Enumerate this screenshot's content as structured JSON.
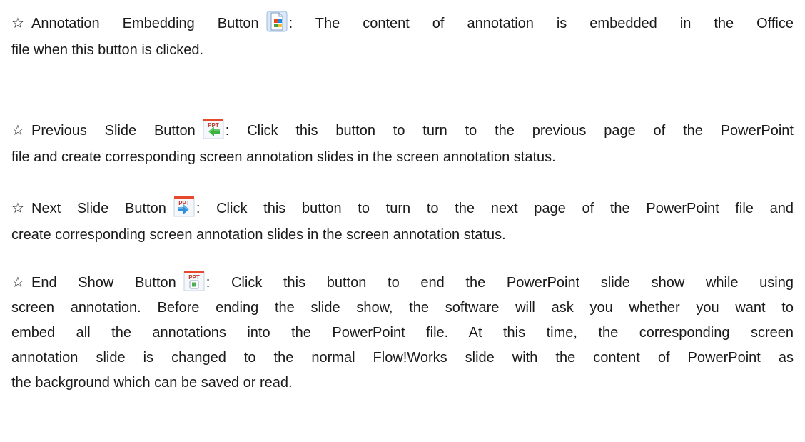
{
  "items": [
    {
      "icon": "annotation-embed-icon",
      "bullet": "☆",
      "line1_before_icon": "Annotation Embedding Button",
      "line1_after_icon": ": The content of annotation is embedded in the Office",
      "line2": "file when this button is clicked."
    },
    {
      "icon": "ppt-previous-slide-icon",
      "bullet": "☆",
      "line1_before_icon": "Previous Slide Button",
      "line1_after_icon": ": Click this button to turn to the previous page of the PowerPoint",
      "line2": "file and create corresponding screen annotation slides in the screen annotation status."
    },
    {
      "icon": "ppt-next-slide-icon",
      "bullet": "☆",
      "line1_before_icon": "Next Slide Button",
      "line1_after_icon": ": Click this button to turn to the next page of the PowerPoint file and",
      "line2": "create corresponding screen annotation slides in the screen annotation status."
    },
    {
      "icon": "ppt-end-show-icon",
      "bullet": "☆",
      "line1_before_icon": "End Show Button",
      "line1_after_icon": ": Click this button to end the PowerPoint slide show while using",
      "line2": "screen annotation. Before ending the slide show, the software will ask you whether you want to",
      "line3": "embed all the annotations into the PowerPoint file. At this time, the corresponding screen",
      "line4": "annotation slide is changed to the normal Flow!Works slide with the content of PowerPoint as",
      "line5": "the background which can be saved or read."
    }
  ],
  "icon_labels": {
    "ppt": "PPT"
  },
  "colors": {
    "text": "#1a1a1a",
    "ppt_red": "#c0392b",
    "ppt_bar": "#e8492c",
    "arrow_green": "#3cb043",
    "arrow_blue": "#2f8fd8",
    "stop_green": "#4caf50"
  }
}
